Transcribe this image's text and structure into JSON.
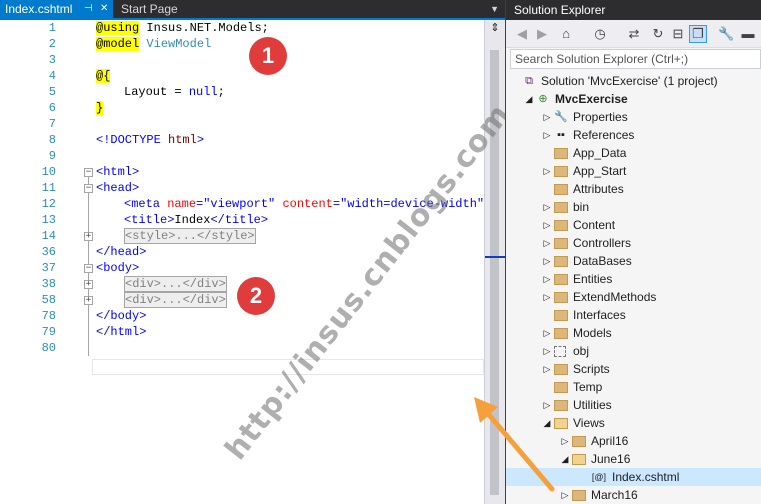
{
  "editor": {
    "active_tab": "Index.cshtml",
    "inactive_tab": "Start Page",
    "lines": [
      {
        "n": "1"
      },
      {
        "n": "2"
      },
      {
        "n": "3"
      },
      {
        "n": "4"
      },
      {
        "n": "5"
      },
      {
        "n": "6"
      },
      {
        "n": "7"
      },
      {
        "n": "8"
      },
      {
        "n": "9"
      },
      {
        "n": "10"
      },
      {
        "n": "11"
      },
      {
        "n": "12"
      },
      {
        "n": "13"
      },
      {
        "n": "14"
      },
      {
        "n": "36"
      },
      {
        "n": "37"
      },
      {
        "n": "38"
      },
      {
        "n": "58"
      },
      {
        "n": "78"
      },
      {
        "n": "79"
      },
      {
        "n": "80"
      }
    ],
    "code": {
      "l1_dir": "@using",
      "l1_rest": " Insus.NET.Models;",
      "l2_dir": "@model",
      "l2_rest": " ViewModel",
      "l4": "@{",
      "l5_a": "Layout = ",
      "l5_b": "null",
      "l5_c": ";",
      "l6": "}",
      "l8_a": "<!DOCTYPE ",
      "l8_b": "html",
      "l8_c": ">",
      "l10": "<html>",
      "l11": "<head>",
      "l12_a": "<meta ",
      "l12_b": "name",
      "l12_c": "=\"viewport\" ",
      "l12_d": "content",
      "l12_e": "=\"width=device-width\" /",
      "l13_a": "<title>",
      "l13_b": "Index",
      "l13_c": "</title>",
      "l14": "<style>...</style>",
      "l36": "</head>",
      "l37": "<body>",
      "l38": "<div>...</div>",
      "l58": "<div>...</div>",
      "l78": "</body>",
      "l79": "</html>"
    },
    "badges": [
      "1",
      "2"
    ],
    "watermark": "http://insus.cnblogs.com"
  },
  "solution_explorer": {
    "title": "Solution Explorer",
    "search_placeholder": "Search Solution Explorer (Ctrl+;)",
    "toolbar_icons": [
      "back-icon",
      "forward-icon",
      "home-icon",
      "history-icon",
      "sync-icon",
      "refresh-icon",
      "collapse-all-icon",
      "show-all-files-icon",
      "properties-icon",
      "pin-icon"
    ],
    "items": [
      {
        "label": "Solution 'MvcExercise' (1 project)",
        "icon": "solution-icon",
        "indent": 0,
        "exp": ""
      },
      {
        "label": "MvcExercise",
        "icon": "web-project-icon",
        "indent": 1,
        "exp": "open",
        "bold": true
      },
      {
        "label": "Properties",
        "icon": "wrench-icon",
        "indent": 2,
        "exp": "closed"
      },
      {
        "label": "References",
        "icon": "references-icon",
        "indent": 2,
        "exp": "closed"
      },
      {
        "label": "App_Data",
        "icon": "folder-icon",
        "indent": 2,
        "exp": ""
      },
      {
        "label": "App_Start",
        "icon": "folder-icon",
        "indent": 2,
        "exp": "closed"
      },
      {
        "label": "Attributes",
        "icon": "folder-icon",
        "indent": 2,
        "exp": ""
      },
      {
        "label": "bin",
        "icon": "folder-icon",
        "indent": 2,
        "exp": "closed"
      },
      {
        "label": "Content",
        "icon": "folder-icon",
        "indent": 2,
        "exp": "closed"
      },
      {
        "label": "Controllers",
        "icon": "folder-icon",
        "indent": 2,
        "exp": "closed"
      },
      {
        "label": "DataBases",
        "icon": "folder-icon",
        "indent": 2,
        "exp": "closed"
      },
      {
        "label": "Entities",
        "icon": "folder-icon",
        "indent": 2,
        "exp": "closed"
      },
      {
        "label": "ExtendMethods",
        "icon": "folder-icon",
        "indent": 2,
        "exp": "closed"
      },
      {
        "label": "Interfaces",
        "icon": "folder-icon",
        "indent": 2,
        "exp": ""
      },
      {
        "label": "Models",
        "icon": "folder-icon",
        "indent": 2,
        "exp": "closed"
      },
      {
        "label": "obj",
        "icon": "hidden-folder-icon",
        "indent": 2,
        "exp": "closed"
      },
      {
        "label": "Scripts",
        "icon": "folder-icon",
        "indent": 2,
        "exp": "closed"
      },
      {
        "label": "Temp",
        "icon": "folder-icon",
        "indent": 2,
        "exp": ""
      },
      {
        "label": "Utilities",
        "icon": "folder-icon",
        "indent": 2,
        "exp": "closed"
      },
      {
        "label": "Views",
        "icon": "folder-open-icon",
        "indent": 2,
        "exp": "open"
      },
      {
        "label": "April16",
        "icon": "folder-icon",
        "indent": 3,
        "exp": "closed"
      },
      {
        "label": "June16",
        "icon": "folder-open-icon",
        "indent": 3,
        "exp": "open"
      },
      {
        "label": "Index.cshtml",
        "icon": "razor-file-icon",
        "indent": 4,
        "exp": "",
        "selected": true
      },
      {
        "label": "March16",
        "icon": "folder-icon",
        "indent": 3,
        "exp": "closed"
      }
    ]
  }
}
